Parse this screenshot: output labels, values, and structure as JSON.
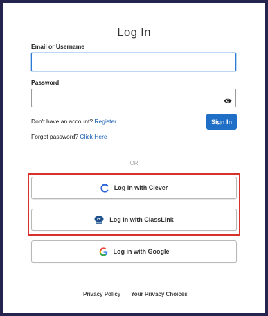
{
  "title": "Log In",
  "email": {
    "label": "Email or Username",
    "value": "",
    "placeholder": ""
  },
  "password": {
    "label": "Password",
    "value": "",
    "placeholder": ""
  },
  "account": {
    "prompt": "Don't have an account?",
    "register_link": "Register"
  },
  "forgot": {
    "prompt": "Forgot password?",
    "link": "Click Here"
  },
  "signin_label": "Sign In",
  "divider_label": "OR",
  "sso": {
    "clever": {
      "label": "Log in with Clever",
      "icon": "clever-icon"
    },
    "classlink": {
      "label": "Log in with ClassLink",
      "icon": "classlink-icon"
    },
    "google": {
      "label": "Log in with Google",
      "icon": "google-icon"
    }
  },
  "footer": {
    "privacy_policy": "Privacy Policy",
    "privacy_choices": "Your Privacy Choices"
  },
  "colors": {
    "page_background": "#24244f",
    "primary": "#1f6fc6",
    "link": "#1a5fb4",
    "highlight_border": "#d8302a",
    "focus_border": "#2b7ad6"
  }
}
